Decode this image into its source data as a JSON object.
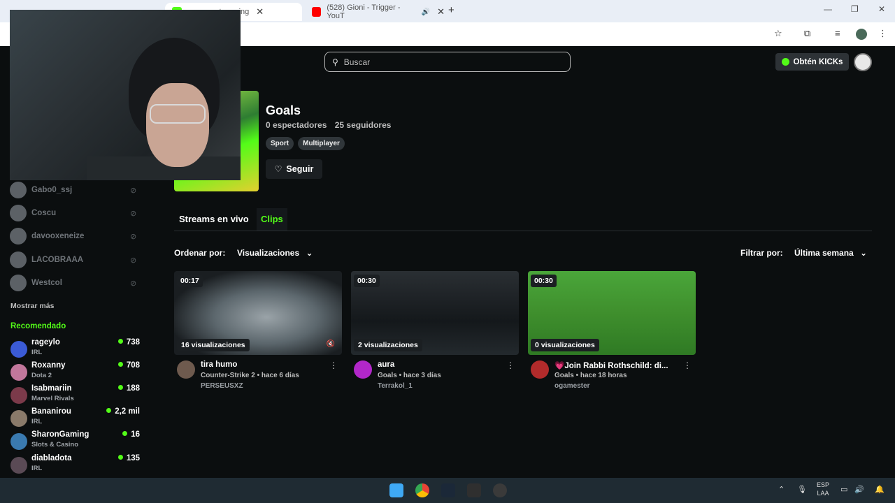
{
  "browser": {
    "tabs": [
      {
        "label": "streaming",
        "close": "✕"
      },
      {
        "label": "(528) Gioni - Trigger - YouT",
        "close": "✕"
      }
    ],
    "new_tab": "+"
  },
  "header": {
    "search_placeholder": "Buscar",
    "kicks_label": "Obtén KICKs"
  },
  "channel": {
    "title": "Goals",
    "viewers": "0 espectadores",
    "followers": "25 seguidores",
    "tags": [
      "Sport",
      "Multiplayer"
    ],
    "follow_label": "Seguir"
  },
  "tabs": {
    "live": "Streams en vivo",
    "clips": "Clips"
  },
  "sort": {
    "label": "Ordenar por:",
    "value": "Visualizaciones",
    "filter_label": "Filtrar por:",
    "filter_value": "Última semana"
  },
  "sidebar": {
    "following": [
      {
        "name": "Gabo0_ssj"
      },
      {
        "name": "Coscu"
      },
      {
        "name": "davooxeneize"
      },
      {
        "name": "LACOBRAAA"
      },
      {
        "name": "Westcol"
      }
    ],
    "show_more": "Mostrar más",
    "recommended_title": "Recomendado",
    "recommended": [
      {
        "name": "rageylo",
        "category": "IRL",
        "viewers": "738",
        "color": "#3b5bd6"
      },
      {
        "name": "Roxanny",
        "category": "Dota 2",
        "viewers": "708",
        "color": "#c2779c"
      },
      {
        "name": "Isabmariin",
        "category": "Marvel Rivals",
        "viewers": "188",
        "color": "#7b3a4a"
      },
      {
        "name": "Bananirou",
        "category": "IRL",
        "viewers": "2,2 mil",
        "color": "#8a7a6a"
      },
      {
        "name": "SharonGaming",
        "category": "Slots & Casino",
        "viewers": "16",
        "color": "#3a7ab0"
      },
      {
        "name": "diabladota",
        "category": "IRL",
        "viewers": "135",
        "color": "#5a4a55"
      }
    ]
  },
  "clips": [
    {
      "duration": "00:17",
      "views": "16 visualizaciones",
      "title": "tira humo",
      "meta": "Counter-Strike 2 • hace 6 días",
      "user": "PERSEUSXZ",
      "thumb": "#3b4248",
      "avatar": "#6e5a4e"
    },
    {
      "duration": "00:30",
      "views": "2 visualizaciones",
      "title": "aura",
      "meta": "Goals • hace 3 días",
      "user": "Terrakol_1",
      "thumb": "#1e2327",
      "avatar": "#b227c9"
    },
    {
      "duration": "00:30",
      "views": "0 visualizaciones",
      "title": "💗Join Rabbi Rothschild: di...",
      "meta": "Goals • hace 18 horas",
      "user": "ogamester",
      "thumb": "#3f8f2d",
      "avatar": "#b22b2b"
    }
  ],
  "taskbar": {
    "lang_top": "ESP",
    "lang_bottom": "LAA"
  }
}
